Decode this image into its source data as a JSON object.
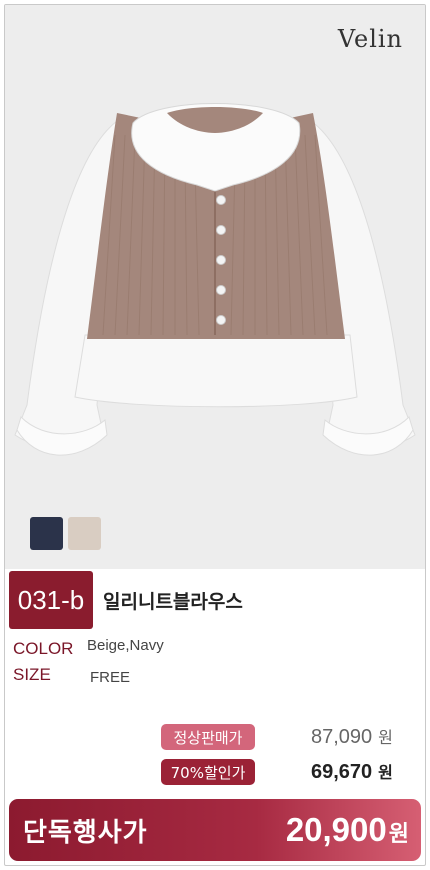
{
  "brand": "Velin",
  "product": {
    "code": "031-b",
    "name": "일리니트블라우스"
  },
  "swatches": [
    {
      "name": "navy",
      "color": "#2b334a"
    },
    {
      "name": "beige",
      "color": "#d9cdc2"
    }
  ],
  "specs": {
    "color_label": "COLOR",
    "color_value": "Beige,Navy",
    "size_label": "SIZE",
    "size_value": "FREE"
  },
  "pricing": {
    "regular_tag": "정상판매가",
    "regular_price": "87,090",
    "discount_tag": "70%할인가",
    "discount_price": "69,670",
    "currency": "원",
    "special_label": "단독행사가",
    "special_price": "20,900"
  },
  "colors": {
    "accent": "#8a1c2e",
    "regular_tag": "#d3667b",
    "discount_tag": "#9b2236"
  }
}
